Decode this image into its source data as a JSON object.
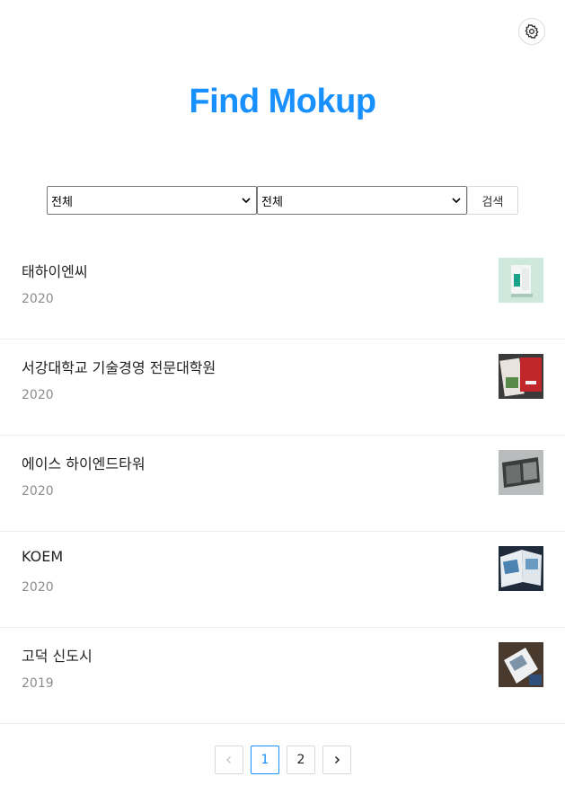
{
  "header": {
    "title": "Find Mokup",
    "settings_icon": "gear-icon"
  },
  "filters": {
    "category_select": "전체",
    "year_select": "전체",
    "search_label": "검색"
  },
  "items": [
    {
      "name": "태하이엔씨",
      "year": "2020"
    },
    {
      "name": "서강대학교 기술경영 전문대학원",
      "year": "2020"
    },
    {
      "name": "에이스 하이엔드타워",
      "year": "2020"
    },
    {
      "name": "KOEM",
      "year": "2020"
    },
    {
      "name": "고덕 신도시",
      "year": "2019"
    }
  ],
  "pagination": {
    "prev_icon": "chevron-left-icon",
    "pages": [
      "1",
      "2"
    ],
    "current": "1",
    "next_icon": "chevron-right-icon"
  },
  "colors": {
    "accent": "#1890ff",
    "muted_text": "#8c8c8c",
    "divider": "#ececec"
  }
}
